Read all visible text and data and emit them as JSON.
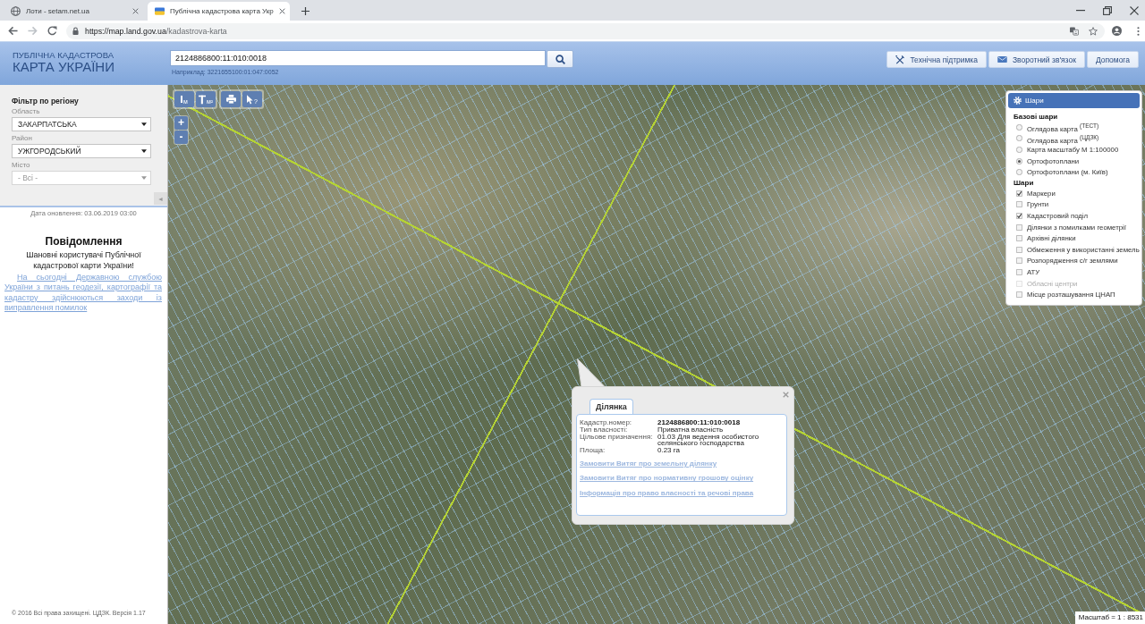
{
  "browser": {
    "tabs": [
      {
        "kind": "globe",
        "title": "Лоти - setam.net.ua",
        "selected": false
      },
      {
        "kind": "flag",
        "title": "Публічна кадастрова карта Укр",
        "selected": true
      }
    ],
    "address": {
      "host": "https://map.land.gov.ua",
      "path": "/kadastrova-karta"
    }
  },
  "header": {
    "logo": {
      "caption": "ПУБЛІЧНА КАДАСТРОВА",
      "title": "КАРТА УКРАЇНИ"
    },
    "search": {
      "value": "2124886800:11:010:0018",
      "example": "Наприклад: 3221655100:01:047:0052"
    },
    "buttons": [
      {
        "kind": "tools",
        "label": "Технічна підтримка"
      },
      {
        "kind": "mail",
        "label": "Зворотний зв'язок"
      },
      {
        "kind": "text",
        "label": "Допомога"
      }
    ]
  },
  "sidebar": {
    "filter": {
      "title": "Фільтр по регіону",
      "fields": [
        {
          "label": "Область",
          "value": "ЗАКАРПАТСЬКА",
          "disabled": false
        },
        {
          "label": "Район",
          "value": "УЖГОРОДСЬКИЙ",
          "disabled": false
        },
        {
          "label": "Місто",
          "value": "- Всі -",
          "disabled": true
        }
      ],
      "collapse": "◄"
    },
    "updated": "Дата оновлення: 03.06.2019 03:00",
    "notice": {
      "title": "Повідомлення",
      "greeting": "Шановні користувачі Публічної кадастрової карти України!",
      "link": "На сьогодні Державною службою України з питань геодезії, картографії та кадастру здійснюються заходи із виправлення помилок"
    },
    "footer": "© 2016 Всі права захищені. ЦДЗК. Версія 1.17"
  },
  "map": {
    "tool_groups": [
      {
        "tools": [
          {
            "kind": "length",
            "label": "м"
          },
          {
            "kind": "area",
            "label": "м²"
          }
        ]
      },
      {
        "tools": [
          {
            "kind": "print"
          },
          {
            "kind": "identify",
            "label": "?"
          }
        ]
      }
    ],
    "zoom": {
      "in": "+",
      "out": "-"
    },
    "layers": {
      "title": "Шари",
      "base_title": "Базові шари",
      "base": [
        {
          "label": "Оглядова карта $^{(ТЕСТ)}$",
          "selected": false
        },
        {
          "label": "Оглядова карта $^{(ЦДЗК)}$",
          "selected": false
        },
        {
          "label": "Карта масштабу М 1:100000",
          "selected": false
        },
        {
          "label": "Ортофотоплани",
          "selected": true
        },
        {
          "label": "Ортофотоплани (м. Київ)",
          "selected": false
        }
      ],
      "overlay_title": "Шари",
      "overlay": [
        {
          "label": "Маркери",
          "checked": true,
          "disabled": false
        },
        {
          "label": "Грунти",
          "checked": false,
          "disabled": false
        },
        {
          "label": "Кадастровий поділ",
          "checked": true,
          "disabled": false
        },
        {
          "label": "Ділянки з помилками геометрії",
          "checked": false,
          "disabled": false
        },
        {
          "label": "Архівні ділянки",
          "checked": false,
          "disabled": false
        },
        {
          "label": "Обмеження у використанні земель",
          "checked": false,
          "disabled": false
        },
        {
          "label": "Розпорядження с/г землями",
          "checked": false,
          "disabled": false
        },
        {
          "label": "АТУ",
          "checked": false,
          "disabled": false
        },
        {
          "label": "Обласні центри",
          "checked": false,
          "disabled": true
        },
        {
          "label": "Місце розташування ЦНАП",
          "checked": false,
          "disabled": false
        }
      ]
    },
    "popup": {
      "tabs": [
        {
          "label": "Ділянка",
          "selected": true
        }
      ],
      "fields": [
        {
          "label": "Кадастр.номер:",
          "value": "2124886800:11:010:0018",
          "bold": true
        },
        {
          "label": "Тип власності:",
          "value": "Приватна власність",
          "bold": false
        },
        {
          "label": "Цільове призначення:",
          "value": "01.03 Для ведення особистого селянського господарства",
          "bold": false
        },
        {
          "label": "Площа:",
          "value": "0.23 га",
          "bold": false
        }
      ],
      "links": [
        "Замовити Витяг про земельну ділянку",
        "Замовити Витяг про нормативну грошову оцінку",
        "Інформація про право власності та речові права"
      ]
    },
    "scale": "Масштаб = 1 : 8531"
  }
}
